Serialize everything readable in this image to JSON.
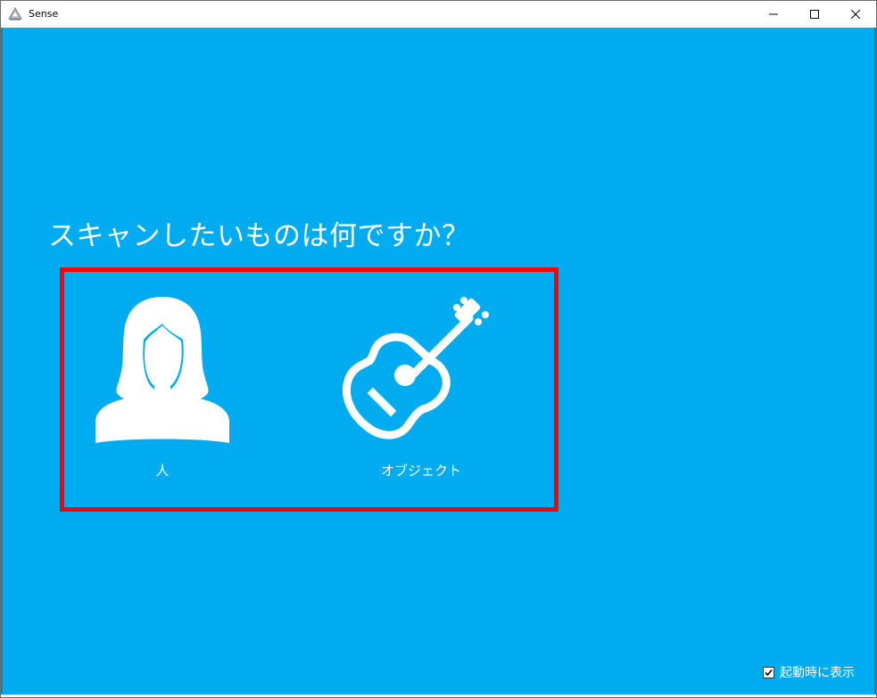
{
  "window": {
    "title": "Sense",
    "controls": {
      "minimize_icon": "minimize-icon",
      "maximize_icon": "maximize-icon",
      "close_icon": "close-icon"
    }
  },
  "main": {
    "prompt": "スキャンしたいものは何ですか？",
    "options": [
      {
        "label": "人",
        "icon": "person-icon"
      },
      {
        "label": "オブジェクト",
        "icon": "guitar-icon"
      }
    ],
    "startup_checkbox": {
      "label": "起動時に表示",
      "checked": true
    }
  },
  "colors": {
    "background": "#00acef",
    "highlight": "#ff0000",
    "text": "#ffffff"
  }
}
